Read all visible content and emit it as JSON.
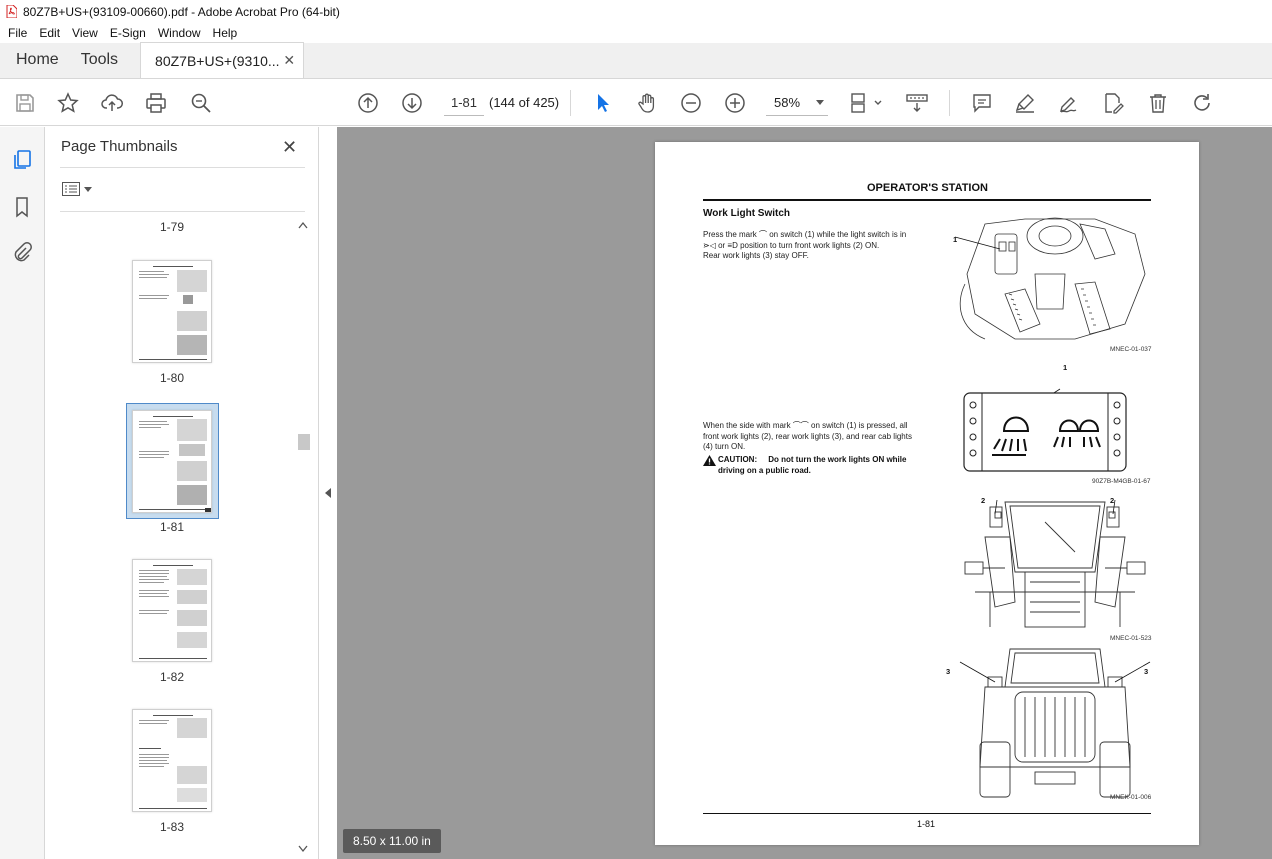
{
  "window": {
    "title": "80Z7B+US+(93109-00660).pdf - Adobe Acrobat Pro (64-bit)",
    "accent_color": "#d32020"
  },
  "menu": [
    "File",
    "Edit",
    "View",
    "E-Sign",
    "Window",
    "Help"
  ],
  "tabs": {
    "home": "Home",
    "tools": "Tools",
    "document": "80Z7B+US+(9310...",
    "close_glyph": "✕"
  },
  "toolbar": {
    "page_input": "1-81",
    "page_count": "(144 of 425)",
    "zoom": "58%",
    "icons": [
      "save-icon",
      "star-icon",
      "upload-icon",
      "print-icon",
      "search-icon",
      "prev-page-icon",
      "next-page-icon",
      "select-arrow-icon",
      "hand-icon",
      "zoom-out-icon",
      "zoom-in-icon",
      "zoom-dropdown-icon",
      "fit-page-icon",
      "scroll-mode-icon",
      "comment-icon",
      "highlight-icon",
      "sign-icon",
      "edit-pdf-icon",
      "delete-icon",
      "redo-icon"
    ]
  },
  "sidebar": {
    "panel_title": "Page Thumbnails",
    "thumbnails": [
      {
        "label": "1-79",
        "selected": false
      },
      {
        "label": "1-80",
        "selected": false
      },
      {
        "label": "1-81",
        "selected": true
      },
      {
        "label": "1-82",
        "selected": false
      },
      {
        "label": "1-83",
        "selected": false
      }
    ]
  },
  "page": {
    "header": "OPERATOR'S STATION",
    "section_title": "Work Light Switch",
    "para1_line1": "Press the mark ⌒ on switch (1) while the light switch is in",
    "para1_line2": "⋗◁ or ≡D position to turn front work lights (2) ON.",
    "para1_line3": "Rear work lights (3) stay OFF.",
    "para2_line1": "When the side with mark ⌒⌒ on switch (1) is pressed, all",
    "para2_line2": "front work lights (2), rear work lights (3), and rear cab lights",
    "para2_line3": "(4) turn ON.",
    "caution_label": "CAUTION:",
    "caution_text_1": "Do not turn the work lights ON while",
    "caution_text_2": "driving on a public road.",
    "fig1_code": "MNEC-01-037",
    "fig2_code": "90Z7B-M4GB-01-67",
    "fig3_code": "MNEC-01-523",
    "fig4_code": "MNEK-01-006",
    "callout_1": "1",
    "callout_2": "2",
    "callout_3": "3",
    "page_number": "1-81"
  },
  "status": {
    "page_size": "8.50 x 11.00 in"
  }
}
